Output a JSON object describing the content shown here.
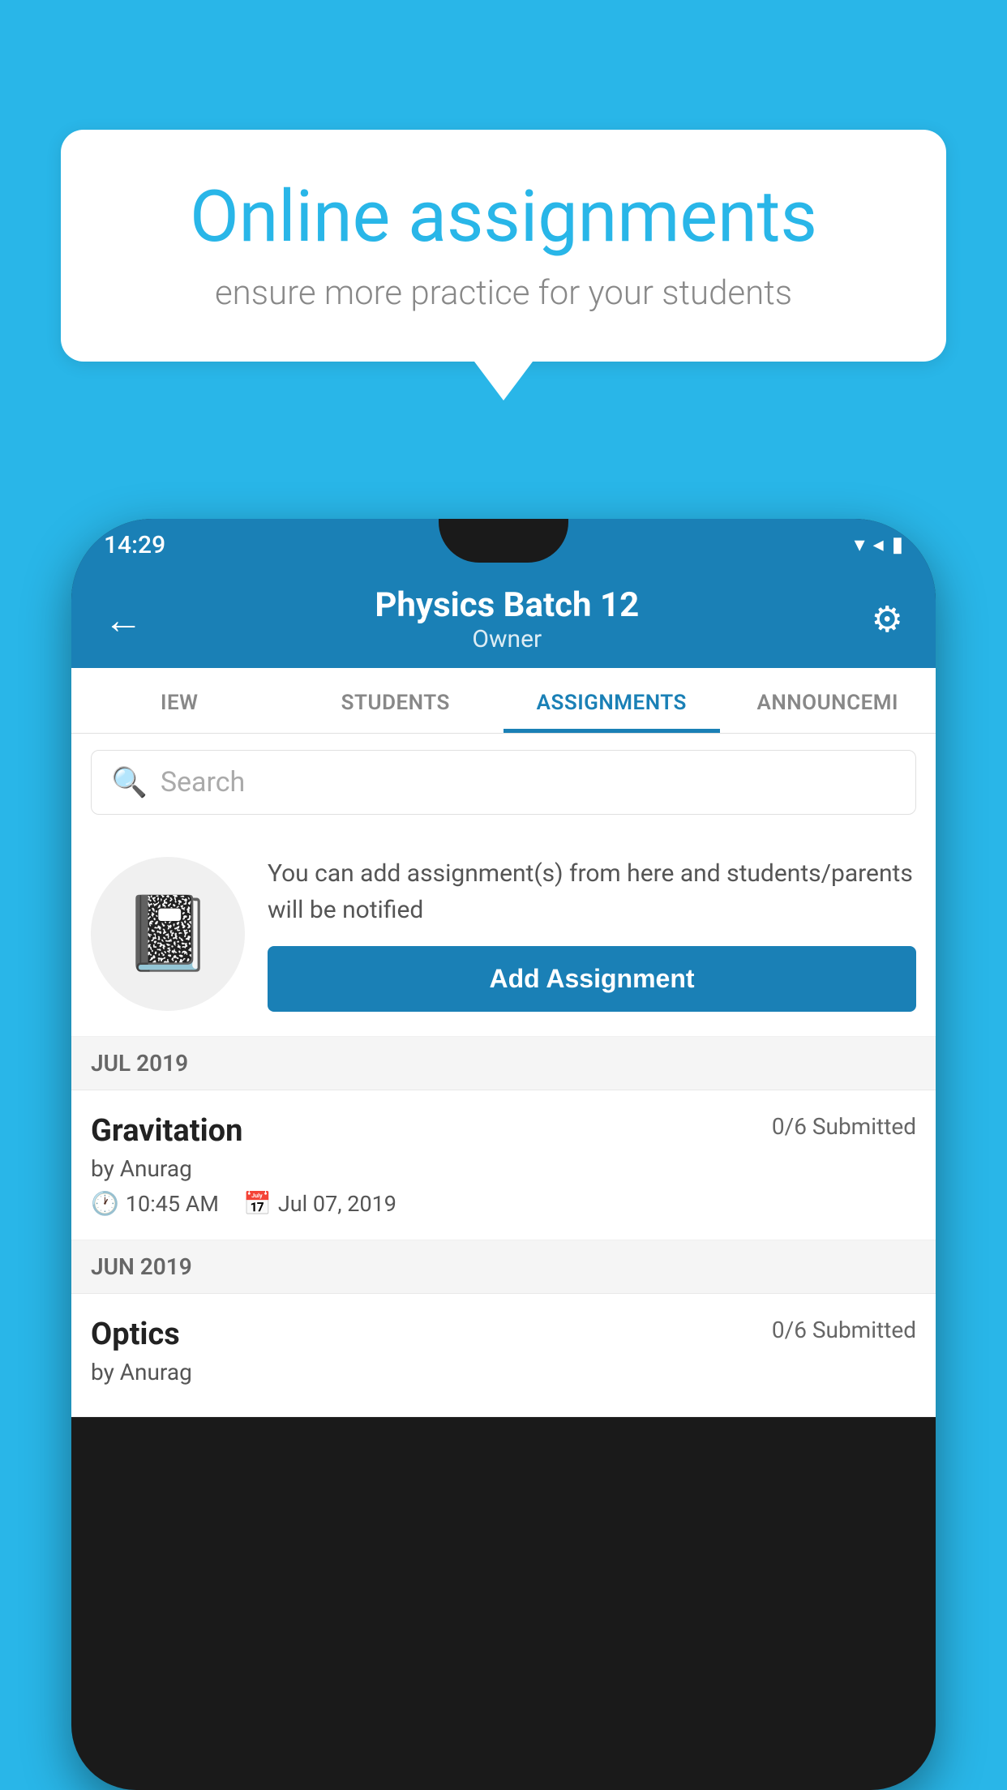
{
  "background_color": "#29b6e8",
  "speech_bubble": {
    "title": "Online assignments",
    "subtitle": "ensure more practice for your students"
  },
  "phone": {
    "status_bar": {
      "time": "14:29",
      "icons": "▾◂▮"
    },
    "header": {
      "title": "Physics Batch 12",
      "subtitle": "Owner",
      "back_label": "←",
      "settings_label": "⚙"
    },
    "tabs": [
      {
        "label": "IEW",
        "active": false
      },
      {
        "label": "STUDENTS",
        "active": false
      },
      {
        "label": "ASSIGNMENTS",
        "active": true
      },
      {
        "label": "ANNOUNCEMI",
        "active": false
      }
    ],
    "search": {
      "placeholder": "Search"
    },
    "promo": {
      "description": "You can add assignment(s) from here and students/parents will be notified",
      "button_label": "Add Assignment"
    },
    "sections": [
      {
        "label": "JUL 2019",
        "assignments": [
          {
            "name": "Gravitation",
            "submitted": "0/6 Submitted",
            "by": "by Anurag",
            "time": "10:45 AM",
            "date": "Jul 07, 2019"
          }
        ]
      },
      {
        "label": "JUN 2019",
        "assignments": [
          {
            "name": "Optics",
            "submitted": "0/6 Submitted",
            "by": "by Anurag",
            "time": "",
            "date": ""
          }
        ]
      }
    ]
  }
}
